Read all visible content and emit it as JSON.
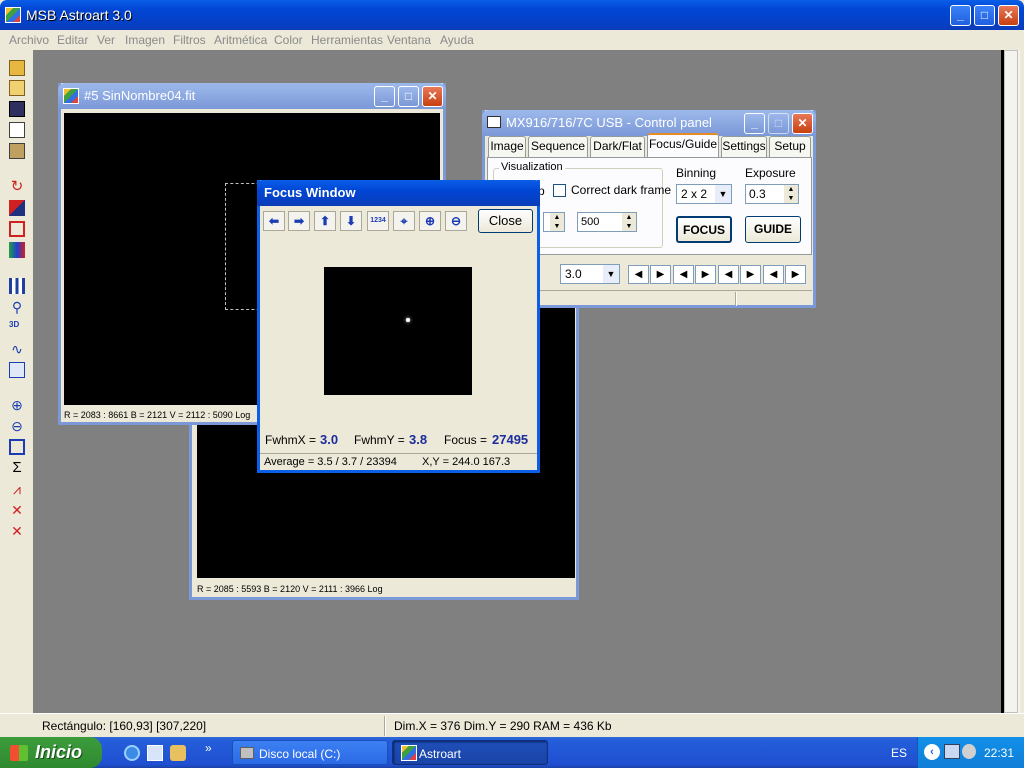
{
  "app": {
    "title": "MSB Astroart 3.0"
  },
  "menu": [
    "Archivo",
    "Editar",
    "Ver",
    "Imagen",
    "Filtros",
    "Aritmética",
    "Color",
    "Herramientas",
    "Ventana",
    "Ayuda"
  ],
  "toolbar_icons": [
    "open-icon",
    "open-multiple-icon",
    "save-icon",
    "copy-icon",
    "paste-icon",
    "rotate-icon",
    "align-icon",
    "frame-icon",
    "color-balance-icon",
    "histogram-icon",
    "zoom-star-icon",
    "3d-plot-icon",
    "curve-icon",
    "info-icon",
    "zoom-in-icon",
    "zoom-out-icon",
    "zoom-window-icon",
    "sum-icon",
    "graph-icon",
    "expand-icon",
    "contract-icon"
  ],
  "image_window_1": {
    "title": "#5 SinNombre04.fit",
    "stats": "R = 2083 : 8661   B = 2121   V = 2112 : 5090 Log"
  },
  "image_window_2": {
    "stats": "R = 2085 : 5593   B = 2120   V = 2111 : 3966 Log"
  },
  "control_panel": {
    "title": "MX916/716/7C USB - Control panel",
    "tabs": [
      "Image",
      "Sequence",
      "Dark/Flat",
      "Focus/Guide",
      "Settings",
      "Setup"
    ],
    "selected_tab": "Focus/Guide",
    "visualization_label": "Visualization",
    "partial_check_label": "p",
    "correct_dark_label": "Correct dark frame",
    "spin_value": "500",
    "binning_label": "Binning",
    "binning_value": "2 x 2",
    "exposure_label": "Exposure",
    "exposure_value": "0.3",
    "focus_button": "FOCUS",
    "guide_button": "GUIDE",
    "combo_value": "3.0"
  },
  "focus_window": {
    "title": "Focus Window",
    "close_label": "Close",
    "fwhmx_label": "FwhmX =",
    "fwhmx_value": "3.0",
    "fwhmy_label": "FwhmY =",
    "fwhmy_value": "3.8",
    "focus_label": "Focus =",
    "focus_value": "27495",
    "average": "Average = 3.5 / 3.7 / 23394",
    "xy": "X,Y = 244.0   167.3"
  },
  "status": {
    "rect": "Rectángulo:  [160,93] [307,220]",
    "dims": "Dim.X = 376   Dim.Y = 290   RAM = 436 Kb"
  },
  "taskbar": {
    "start": "Inicio",
    "tasks": [
      "Disco local (C:)",
      "Astroart"
    ],
    "lang": "ES",
    "clock": "22:31"
  },
  "colors": {
    "xp_blue": "#0a5ee8",
    "mdi_gray": "#808080",
    "focus_value_color": "#1c2c9c"
  }
}
